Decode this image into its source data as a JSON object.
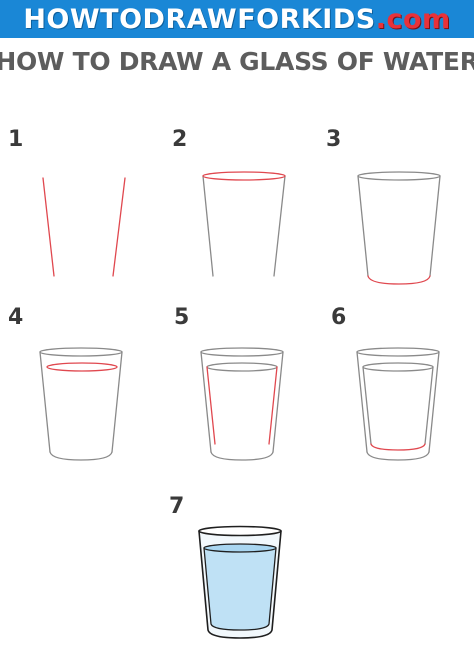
{
  "header": {
    "site_name_main": "HOWTODRAWFORKIDS",
    "site_name_tld": ".com",
    "headline": "HOW TO DRAW A GLASS OF WATER"
  },
  "steps": [
    {
      "number": "1"
    },
    {
      "number": "2"
    },
    {
      "number": "3"
    },
    {
      "number": "4"
    },
    {
      "number": "5"
    },
    {
      "number": "6"
    },
    {
      "number": "7"
    }
  ],
  "colors": {
    "banner": "#1a87d6",
    "tld": "#e8323a",
    "headline": "#5d5d5d",
    "pencil_line": "#8a8a8a",
    "new_line": "#e0484f",
    "water_fill": "#bfe1f5",
    "glass_fill": "#f2f8fc",
    "outline": "#1f1f1f"
  }
}
